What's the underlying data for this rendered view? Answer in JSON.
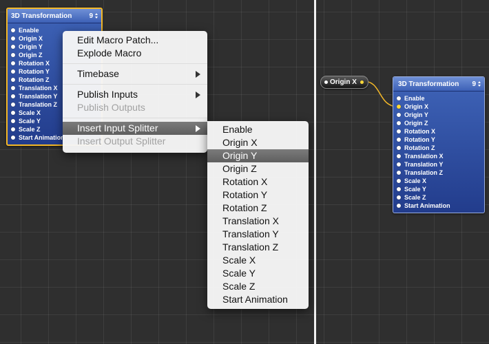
{
  "left_patch": {
    "title": "3D Transformation",
    "count": "9",
    "ports": [
      "Enable",
      "Origin X",
      "Origin Y",
      "Origin Z",
      "Rotation X",
      "Rotation Y",
      "Rotation Z",
      "Translation X",
      "Translation Y",
      "Translation Z",
      "Scale X",
      "Scale Y",
      "Scale Z",
      "Start Animation"
    ]
  },
  "right_patch": {
    "title": "3D Transformation",
    "count": "9",
    "ports": [
      "Enable",
      "Origin X",
      "Origin Y",
      "Origin Z",
      "Rotation X",
      "Rotation Y",
      "Rotation Z",
      "Translation X",
      "Translation Y",
      "Translation Z",
      "Scale X",
      "Scale Y",
      "Scale Z",
      "Start Animation"
    ],
    "connected_port": "Origin X"
  },
  "splitter": {
    "label": "Origin X"
  },
  "context_menu": {
    "items": [
      {
        "label": "Edit Macro Patch...",
        "enabled": true
      },
      {
        "label": "Explode Macro",
        "enabled": true
      },
      {
        "label": "Timebase",
        "enabled": true,
        "submenu": true
      },
      {
        "label": "Publish Inputs",
        "enabled": true,
        "submenu": true
      },
      {
        "label": "Publish Outputs",
        "enabled": false
      },
      {
        "label": "Insert Input Splitter",
        "enabled": true,
        "submenu": true,
        "highlighted": true
      },
      {
        "label": "Insert Output Splitter",
        "enabled": false
      }
    ]
  },
  "submenu": {
    "selected": "Origin Y",
    "items": [
      "Enable",
      "Origin X",
      "Origin Y",
      "Origin Z",
      "Rotation X",
      "Rotation Y",
      "Rotation Z",
      "Translation X",
      "Translation Y",
      "Translation Z",
      "Scale X",
      "Scale Y",
      "Scale Z",
      "Start Animation"
    ]
  },
  "colors": {
    "canvas": "#2f2f2f",
    "patch_blue": "#2d4ea6",
    "selection_orange": "#f5b928",
    "connection_yellow": "#f5b928",
    "menu_highlight": "#6b6b6b"
  }
}
